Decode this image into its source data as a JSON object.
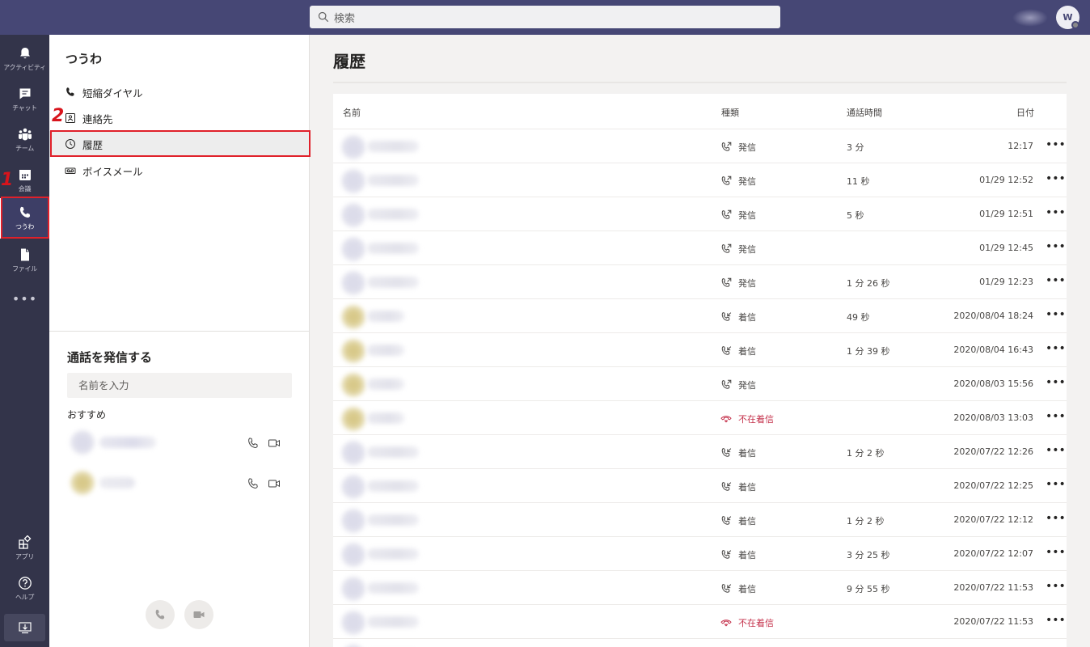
{
  "search": {
    "placeholder": "検索"
  },
  "user": {
    "initial": "W"
  },
  "rail": {
    "items": [
      {
        "label": "アクティビティ",
        "icon": "bell-icon"
      },
      {
        "label": "チャット",
        "icon": "chat-icon"
      },
      {
        "label": "チーム",
        "icon": "teams-icon"
      },
      {
        "label": "会議",
        "icon": "calendar-icon"
      },
      {
        "label": "つうわ",
        "icon": "phone-icon",
        "active": true
      },
      {
        "label": "ファイル",
        "icon": "file-icon"
      }
    ],
    "more": "•••",
    "apps_label": "アプリ",
    "help_label": "ヘルプ"
  },
  "steps": {
    "one": "1",
    "two": "2"
  },
  "panel": {
    "title": "つうわ",
    "nav": [
      {
        "label": "短縮ダイヤル",
        "icon": "phone-icon"
      },
      {
        "label": "連絡先",
        "icon": "contact-card-icon"
      },
      {
        "label": "履歴",
        "icon": "clock-icon",
        "selected": true
      },
      {
        "label": "ボイスメール",
        "icon": "voicemail-icon"
      }
    ],
    "dial_title": "通話を発信する",
    "name_placeholder": "名前を入力",
    "recommended_label": "おすすめ"
  },
  "main": {
    "title": "履歴",
    "columns": {
      "name": "名前",
      "type": "種類",
      "duration": "通話時間",
      "date": "日付"
    },
    "rows": [
      {
        "type": "発信",
        "kind": "out",
        "duration": "3 分",
        "date": "12:17",
        "tint": "gray"
      },
      {
        "type": "発信",
        "kind": "out",
        "duration": "11 秒",
        "date": "01/29 12:52",
        "tint": "gray"
      },
      {
        "type": "発信",
        "kind": "out",
        "duration": "5 秒",
        "date": "01/29 12:51",
        "tint": "gray"
      },
      {
        "type": "発信",
        "kind": "out",
        "duration": "",
        "date": "01/29 12:45",
        "tint": "gray"
      },
      {
        "type": "発信",
        "kind": "out",
        "duration": "1 分 26 秒",
        "date": "01/29 12:23",
        "tint": "gray"
      },
      {
        "type": "着信",
        "kind": "in",
        "duration": "49 秒",
        "date": "2020/08/04 18:24",
        "tint": "gold"
      },
      {
        "type": "着信",
        "kind": "in",
        "duration": "1 分 39 秒",
        "date": "2020/08/04 16:43",
        "tint": "gold"
      },
      {
        "type": "発信",
        "kind": "out",
        "duration": "",
        "date": "2020/08/03 15:56",
        "tint": "gold"
      },
      {
        "type": "不在着信",
        "kind": "missed",
        "duration": "",
        "date": "2020/08/03 13:03",
        "tint": "gold"
      },
      {
        "type": "着信",
        "kind": "in",
        "duration": "1 分 2 秒",
        "date": "2020/07/22 12:26",
        "tint": "gray"
      },
      {
        "type": "着信",
        "kind": "in",
        "duration": "",
        "date": "2020/07/22 12:25",
        "tint": "gray"
      },
      {
        "type": "着信",
        "kind": "in",
        "duration": "1 分 2 秒",
        "date": "2020/07/22 12:12",
        "tint": "gray"
      },
      {
        "type": "着信",
        "kind": "in",
        "duration": "3 分 25 秒",
        "date": "2020/07/22 12:07",
        "tint": "gray"
      },
      {
        "type": "着信",
        "kind": "in",
        "duration": "9 分 55 秒",
        "date": "2020/07/22 11:53",
        "tint": "gray"
      },
      {
        "type": "不在着信",
        "kind": "missed",
        "duration": "",
        "date": "2020/07/22 11:53",
        "tint": "gray"
      },
      {
        "type": "",
        "kind": "none",
        "duration": "",
        "date": "",
        "tint": "gray"
      }
    ],
    "more_label": "•••"
  },
  "colors": {
    "topbar": "#464775",
    "rail": "#33344a",
    "accent": "#e0202a",
    "missed": "#c4314b"
  }
}
